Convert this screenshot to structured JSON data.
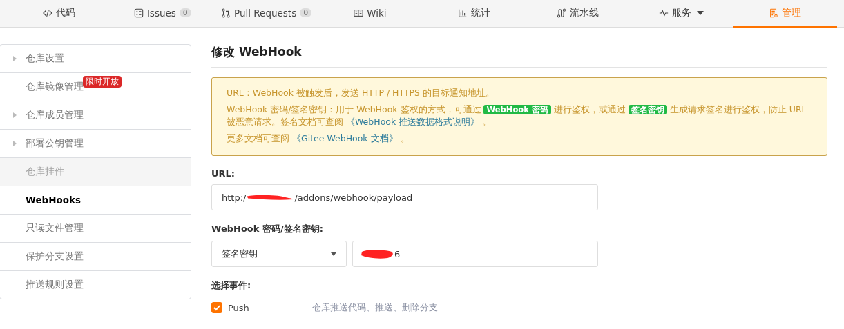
{
  "tabs": [
    {
      "label": "代码",
      "selected": false
    },
    {
      "label": "Issues",
      "count": "0",
      "selected": false
    },
    {
      "label": "Pull Requests",
      "count": "0",
      "selected": false
    },
    {
      "label": "Wiki",
      "selected": false
    },
    {
      "label": "统计",
      "selected": false
    },
    {
      "label": "流水线",
      "selected": false
    },
    {
      "label": "服务",
      "dropdown": true,
      "selected": false
    },
    {
      "label": "管理",
      "selected": true
    }
  ],
  "sidebar": {
    "items": [
      {
        "label": "仓库设置",
        "expandable": true,
        "disabled": false,
        "selected": false
      },
      {
        "label": "仓库镜像管理",
        "expandable": false,
        "disabled": false,
        "selected": false,
        "badge": "限时开放"
      },
      {
        "label": "仓库成员管理",
        "expandable": true,
        "disabled": false,
        "selected": false
      },
      {
        "label": "部署公钥管理",
        "expandable": true,
        "disabled": false,
        "selected": false
      },
      {
        "label": "仓库挂件",
        "expandable": false,
        "disabled": true,
        "selected": false
      },
      {
        "label": "WebHooks",
        "expandable": false,
        "disabled": false,
        "selected": true
      },
      {
        "label": "只读文件管理",
        "expandable": false,
        "disabled": false,
        "selected": false
      },
      {
        "label": "保护分支设置",
        "expandable": false,
        "disabled": false,
        "selected": false
      },
      {
        "label": "推送规则设置",
        "expandable": false,
        "disabled": false,
        "selected": false
      }
    ]
  },
  "page_title": "修改 WebHook",
  "notice": [
    [
      {
        "kind": "text",
        "text": "URL：WebHook 被触发后，发送 HTTP / HTTPS 的目标通知地址。"
      }
    ],
    [
      {
        "kind": "text",
        "text": "WebHook 密码/签名密钥：用于 WebHook 鉴权的方式，可通过 "
      },
      {
        "kind": "tag",
        "text": "WebHook 密码"
      },
      {
        "kind": "text",
        "text": " 进行鉴权，或通过 "
      },
      {
        "kind": "tag",
        "text": "签名密钥"
      },
      {
        "kind": "text",
        "text": " 生成请求签名进行鉴权，防止 URL 被恶意请求。签名文档可查阅 "
      },
      {
        "kind": "link",
        "text": "《WebHook 推送数据格式说明》"
      },
      {
        "kind": "text",
        "text": " 。"
      }
    ],
    [
      {
        "kind": "text",
        "text": "更多文档可查阅 "
      },
      {
        "kind": "link",
        "text": "《Gitee WebHook 文档》"
      },
      {
        "kind": "text",
        "text": " 。"
      }
    ]
  ],
  "url": {
    "label": "URL:",
    "value_start": "http:/",
    "value_end": "/addons/webhook/payload"
  },
  "secret": {
    "label": "WebHook 密码/签名密钥:",
    "type": "签名密钥",
    "value_end": "6"
  },
  "events": {
    "label": "选择事件:",
    "items": [
      {
        "name": "Push",
        "checked": true,
        "description": "仓库推送代码、推送、删除分支"
      }
    ]
  }
}
